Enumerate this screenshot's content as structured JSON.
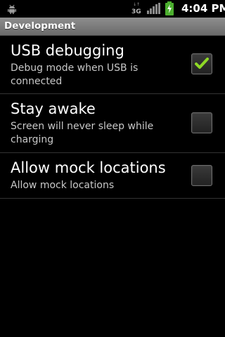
{
  "status_bar": {
    "network_label": "3G",
    "time": "4:04 PM",
    "icons": [
      "android-debug-icon",
      "3g-data-icon",
      "signal-icon",
      "battery-charging-icon"
    ],
    "battery_color": "#4caf2f"
  },
  "header": {
    "title": "Development"
  },
  "preferences": [
    {
      "title": "USB debugging",
      "summary": "Debug mode when USB is connected",
      "checked": true
    },
    {
      "title": "Stay awake",
      "summary": "Screen will never sleep while charging",
      "checked": false
    },
    {
      "title": "Allow mock locations",
      "summary": "Allow mock locations",
      "checked": false
    }
  ],
  "colors": {
    "background": "#000000",
    "title_bar": "#7c7c7c",
    "check_green": "#8fd926",
    "summary_text": "#c8c8c8"
  }
}
